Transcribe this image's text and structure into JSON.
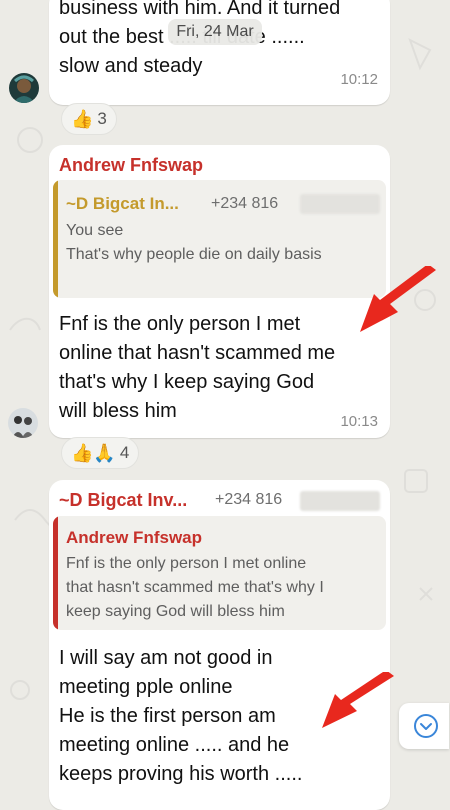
{
  "date_chip": "Fri, 24 Mar",
  "messages": [
    {
      "text": "business with him. And it turned\nout the best ..... till date ......\nslow and steady",
      "time": "10:12",
      "reaction": {
        "emoji": "👍",
        "count": "3"
      }
    },
    {
      "sender": "Andrew Fnfswap",
      "quote": {
        "name": "~D Bigcat In...",
        "phone": "+234 816",
        "text": "You see\nThat's why people die on daily basis"
      },
      "text": "Fnf is the only person I met\nonline that hasn't scammed me\nthat's why I keep saying God\nwill bless him",
      "time": "10:13",
      "reaction": {
        "emoji": "👍🙏",
        "count": "4"
      }
    },
    {
      "sender": "~D Bigcat Inv...",
      "phone": "+234 816",
      "quote": {
        "name": "Andrew Fnfswap",
        "text": "Fnf is the only person I met online\nthat hasn't scammed me that's why I\nkeep saying God will bless him"
      },
      "text": "I will say am not good in\nmeeting pple online\nHe is the first person am\nmeeting online ..... and he\nkeeps proving his worth ....."
    }
  ],
  "colors": {
    "background": "#ecebe6",
    "sender_red": "#c6312b",
    "quote_bar_gold": "#c49a2c",
    "arrow_red": "#e8281e",
    "scroll_blue": "#3a86d9"
  },
  "icons": {
    "scroll": "chevron-down-circle-icon",
    "arrow": "red-arrow-annotation"
  }
}
